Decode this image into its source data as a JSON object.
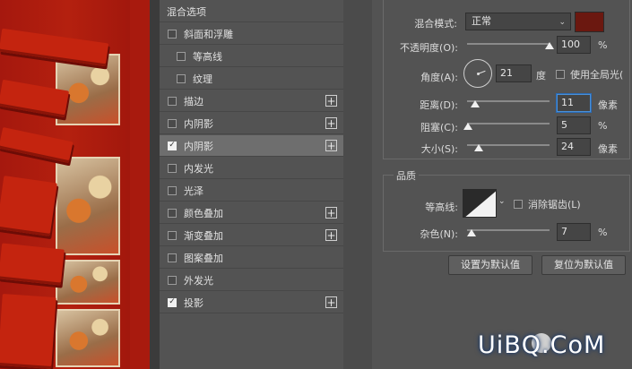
{
  "styles_panel": {
    "header": "混合选项",
    "items": [
      {
        "label": "斜面和浮雕",
        "checked": false,
        "plus": false,
        "indent": false,
        "selected": false
      },
      {
        "label": "等高线",
        "checked": false,
        "plus": false,
        "indent": true,
        "selected": false
      },
      {
        "label": "纹理",
        "checked": false,
        "plus": false,
        "indent": true,
        "selected": false
      },
      {
        "label": "描边",
        "checked": false,
        "plus": true,
        "indent": false,
        "selected": false
      },
      {
        "label": "内阴影",
        "checked": false,
        "plus": true,
        "indent": false,
        "selected": false
      },
      {
        "label": "内阴影",
        "checked": true,
        "plus": true,
        "indent": false,
        "selected": true
      },
      {
        "label": "内发光",
        "checked": false,
        "plus": false,
        "indent": false,
        "selected": false
      },
      {
        "label": "光泽",
        "checked": false,
        "plus": false,
        "indent": false,
        "selected": false
      },
      {
        "label": "颜色叠加",
        "checked": false,
        "plus": true,
        "indent": false,
        "selected": false
      },
      {
        "label": "渐变叠加",
        "checked": false,
        "plus": true,
        "indent": false,
        "selected": false
      },
      {
        "label": "图案叠加",
        "checked": false,
        "plus": false,
        "indent": false,
        "selected": false
      },
      {
        "label": "外发光",
        "checked": false,
        "plus": false,
        "indent": false,
        "selected": false
      },
      {
        "label": "投影",
        "checked": true,
        "plus": true,
        "indent": false,
        "selected": false
      }
    ],
    "plus_glyph": "+",
    "check_glyph": "✓"
  },
  "structure": {
    "blend_mode_label": "混合模式:",
    "blend_mode_value": "正常",
    "blend_color": "#6b1810",
    "opacity_label": "不透明度(O):",
    "opacity_value": "100",
    "opacity_unit": "%",
    "opacity_fraction": 1.0,
    "angle_label": "角度(A):",
    "angle_value": "21",
    "angle_unit": "度",
    "global_light_label": "使用全局光(",
    "distance_label": "距离(D):",
    "distance_value": "11",
    "distance_unit": "像素",
    "choke_label": "阻塞(C):",
    "choke_value": "5",
    "choke_unit": "%",
    "size_label": "大小(S):",
    "size_value": "24",
    "size_unit": "像素"
  },
  "quality": {
    "legend": "品质",
    "contour_label": "等高线:",
    "antialias_label": "消除锯齿(L)",
    "noise_label": "杂色(N):",
    "noise_value": "7",
    "noise_unit": "%"
  },
  "buttons": {
    "set_default": "设置为默认值",
    "reset_default": "复位为默认值"
  },
  "watermark": {
    "text": "UiBQ.CoM"
  }
}
